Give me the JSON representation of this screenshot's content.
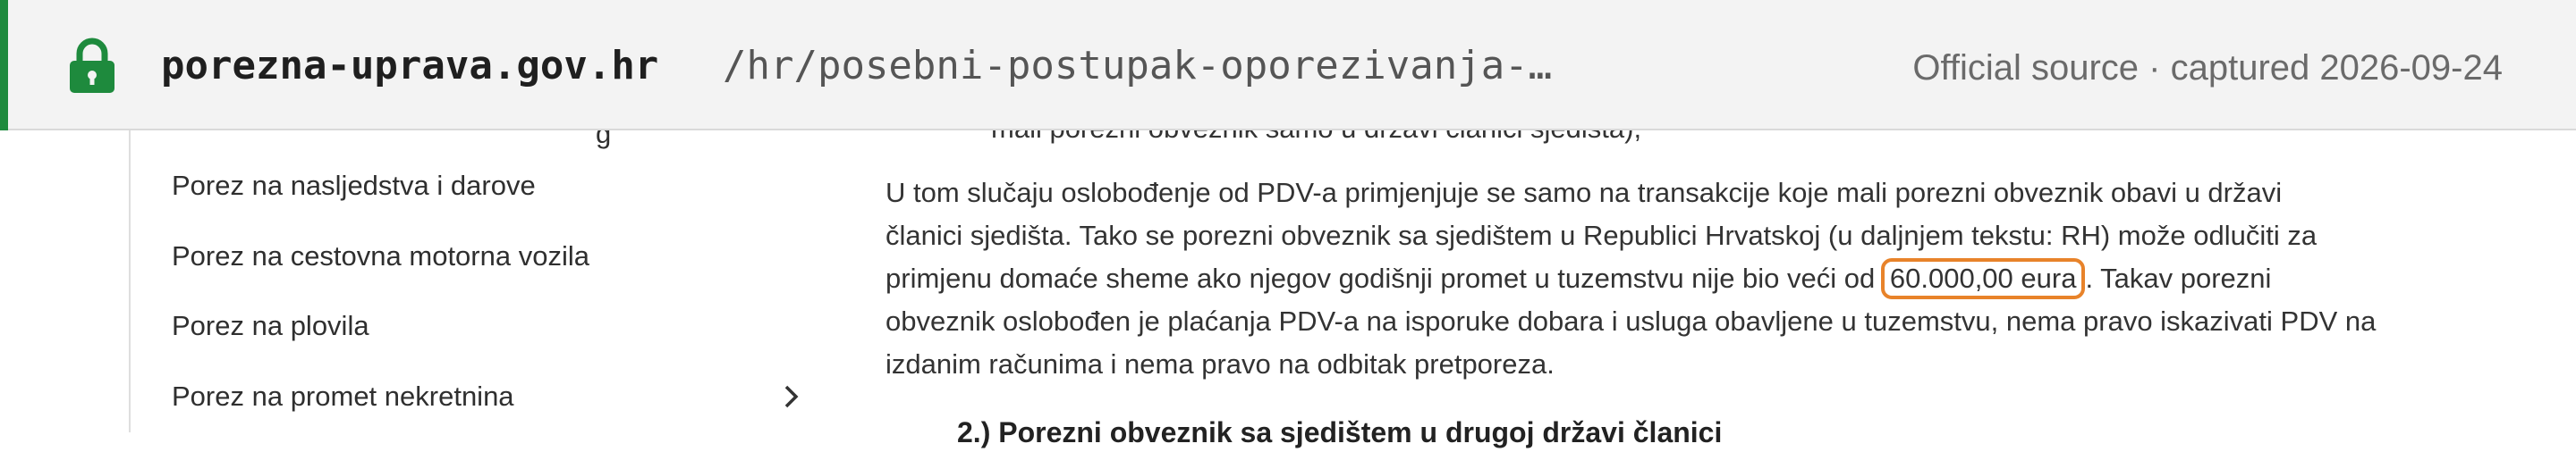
{
  "banner": {
    "domain": "porezna-uprava.gov.hr",
    "path": "/hr/posebni-postupak-oporezivanja-…",
    "source_note": "Official source · captured 2026-09-24",
    "accent_color": "#1e8a3d",
    "icon": "lock-icon"
  },
  "sidebar": {
    "clipped_item": "g",
    "items": [
      {
        "label": "Porez na nasljedstva i darove"
      },
      {
        "label": "Porez na cestovna motorna vozila"
      },
      {
        "label": "Porez na plovila"
      },
      {
        "label": "Porez na promet nekretnina",
        "has_submenu": true
      }
    ]
  },
  "content": {
    "clipped_line": "mali porezni obveznik samo u državi članici sjedišta);",
    "paragraph": {
      "line1": "U tom slučaju oslobođenje od PDV-a primjenjuje se samo na transakcije koje mali porezni obveznik obavi u državi",
      "line2": "članici sjedišta. Tako se porezni obveznik sa sjedištem u Republici Hrvatskoj (u daljnjem tekstu: RH) može odlučiti za",
      "line3_before": "primjenu domaće sheme ako njegov godišnji promet u tuzemstvu nije bio veći od ",
      "highlight": "60.000,00 eura",
      "line3_after": ". Takav porezni",
      "line4": "obveznik oslobođen je plaćanja PDV-a na isporuke dobara i usluga obavljene u tuzemstvu, nema pravo iskazivati PDV na",
      "line5": "izdanim računima i nema pravo na odbitak pretporeza."
    },
    "next_heading": "2.) Porezni obveznik sa sjedištem u drugoj državi članici",
    "highlight_color": "#e8832a"
  }
}
